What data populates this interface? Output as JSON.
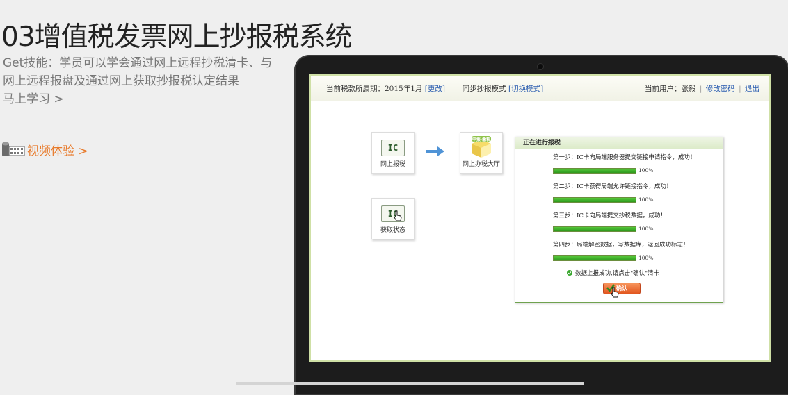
{
  "page": {
    "title": "03增值税发票网上抄报税系统",
    "description": "Get技能：学员可以学会通过网上远程抄税清卡、与网上远程报盘及通过网上获取抄报税认定结果",
    "learn_link": "马上学习 >",
    "video_link": "视频体验 >"
  },
  "app": {
    "period_label": "当前税款所属期：2015年1月",
    "change_link": "[更改]",
    "mode_label": "同步抄报模式",
    "switch_link": "[切换模式]",
    "user_label": "当前用户：张毅",
    "change_password": "修改密码",
    "separator": "|",
    "logout": "退出"
  },
  "tiles": {
    "online_report": {
      "badge": "IC",
      "label": "网上报税"
    },
    "tax_hall": {
      "badge_text": "申报·缴税",
      "label": "网上办税大厅"
    },
    "get_status": {
      "badge": "IC",
      "label": "获取状态"
    }
  },
  "dialog": {
    "title": "正在进行报税",
    "steps": [
      {
        "text": "第一步：IC卡向局端服务器提交链接申请指令，成功！",
        "percent": "100%",
        "progress": 1.0
      },
      {
        "text": "第二步：IC卡获得局端允许链接指令，成功！",
        "percent": "100%",
        "progress": 1.0
      },
      {
        "text": "第三步：IC卡向局端提交抄税数据，成功！",
        "percent": "100%",
        "progress": 1.0
      },
      {
        "text": "第四步：局端解密数据，写数据库，返回成功标志！",
        "percent": "100%",
        "progress": 1.0
      }
    ],
    "success_message": "数据上报成功,请点击\"确认\"清卡",
    "confirm_label": "确认"
  },
  "colors": {
    "accent_orange": "#e87a2a",
    "link_blue": "#2b5db0",
    "progress_green": "#3aad28",
    "dialog_border": "#6fa24f",
    "confirm_button": "#e8652a"
  },
  "icons": [
    "film-reel-icon",
    "arrow-right-icon",
    "ok-check-icon",
    "hand-cursor-icon"
  ]
}
